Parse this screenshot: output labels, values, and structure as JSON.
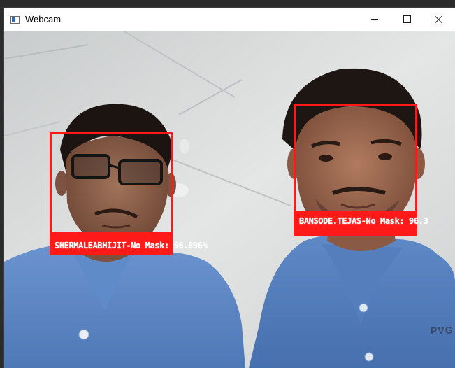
{
  "window": {
    "title": "Webcam",
    "icon": "window-app-icon",
    "controls": [
      "minimize-icon",
      "maximize-icon",
      "close-icon"
    ]
  },
  "detections": [
    {
      "label": "SHERMALEABHIJIT-No Mask: 96.896%",
      "status": "No Mask",
      "color": "#ff1a1a"
    },
    {
      "label": "BANSODE.TEJAS-No Mask: 96.3",
      "status": "No Mask",
      "color": "#ff1a1a"
    }
  ],
  "scene": {
    "shirt_print": "PVG"
  },
  "colors": {
    "box": "#ff1a1a",
    "label_text": "#ffffff",
    "shirt": "#5b86c4",
    "ceiling": "#d9dcdc"
  }
}
